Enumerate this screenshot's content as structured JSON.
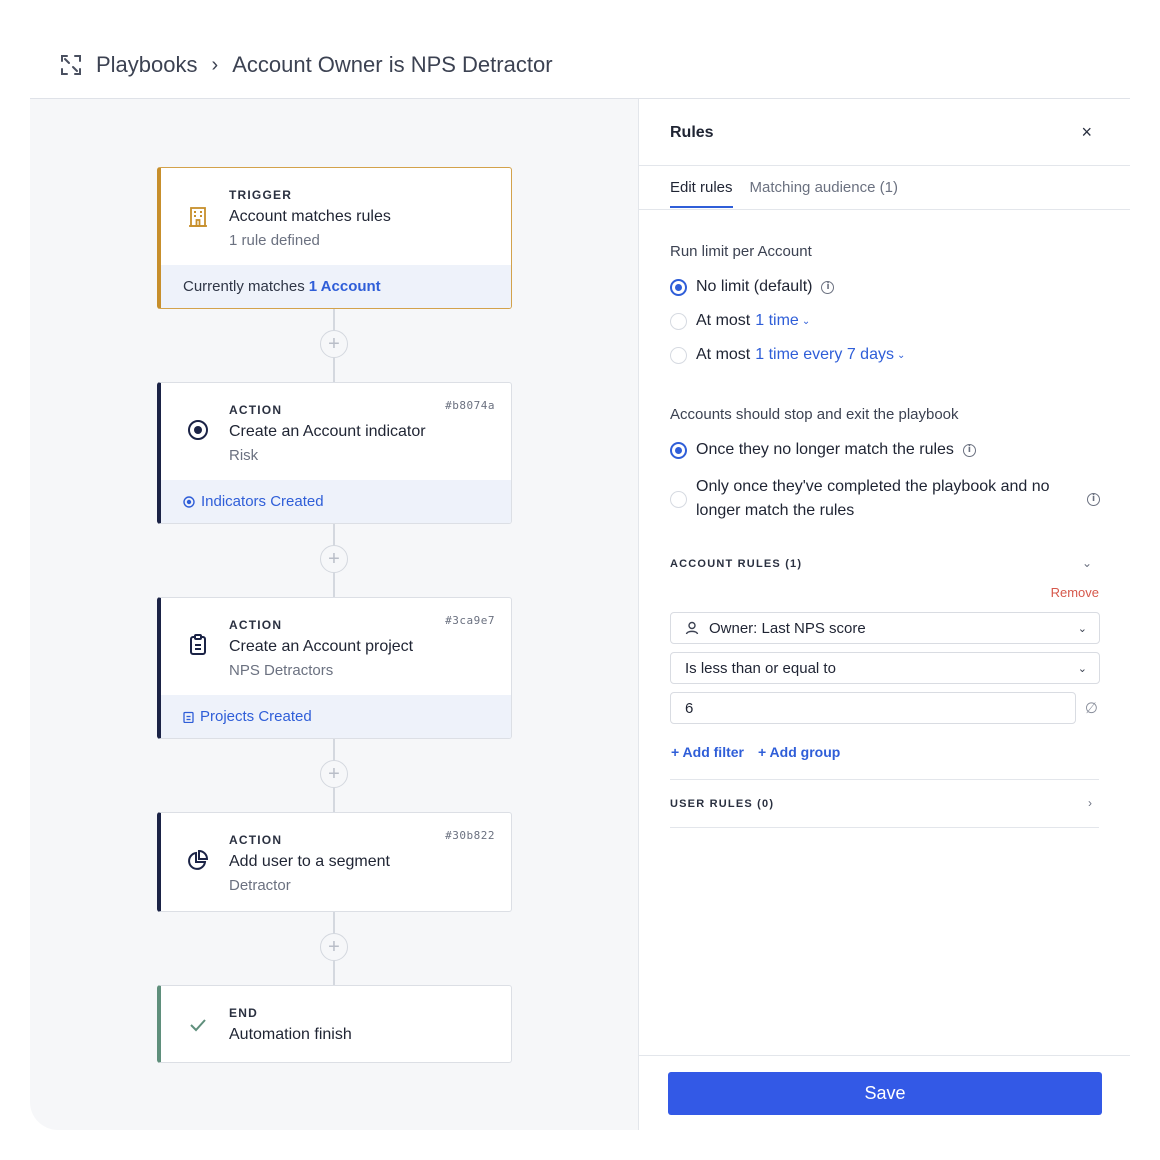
{
  "breadcrumb": {
    "root": "Playbooks",
    "separator": "›",
    "current": "Account Owner is NPS Detractor"
  },
  "flow": {
    "trigger": {
      "kind": "TRIGGER",
      "title": "Account matches rules",
      "subtitle": "1 rule defined",
      "footer_prefix": "Currently matches",
      "footer_link": "1 Account",
      "icon": "building-icon"
    },
    "actions": [
      {
        "kind": "ACTION",
        "id": "#b8074a",
        "title": "Create an Account indicator",
        "subtitle": "Risk",
        "footer": "Indicators Created",
        "icon": "target-icon"
      },
      {
        "kind": "ACTION",
        "id": "#3ca9e7",
        "title": "Create an Account project",
        "subtitle": "NPS Detractors",
        "footer": "Projects Created",
        "icon": "clipboard-icon"
      },
      {
        "kind": "ACTION",
        "id": "#30b822",
        "title": "Add user to a segment",
        "subtitle": "Detractor",
        "icon": "pie-chart-icon"
      }
    ],
    "end": {
      "kind": "END",
      "title": "Automation finish",
      "icon": "check-icon"
    },
    "add_step_symbol": "+"
  },
  "panel": {
    "title": "Rules",
    "close": "×",
    "tabs": [
      "Edit rules",
      "Matching audience (1)"
    ],
    "run_limit": {
      "label": "Run limit per Account",
      "options": [
        {
          "text": "No limit (default)",
          "selected": true
        },
        {
          "text": "At most",
          "link": "1 time",
          "selected": false
        },
        {
          "text": "At most",
          "link": "1 time every 7 days",
          "selected": false
        }
      ]
    },
    "exit": {
      "label": "Accounts should stop and exit the playbook",
      "options": [
        {
          "text": "Once they no longer match the rules",
          "selected": true
        },
        {
          "text_line1": "Only once they've completed the playbook and no",
          "text_line2": "longer match the rules",
          "selected": false
        }
      ]
    },
    "account_rules": {
      "label": "ACCOUNT RULES (1)",
      "remove": "Remove",
      "property": "Owner: Last NPS score",
      "operator": "Is less than or equal to",
      "value": "6",
      "null_symbol": "∅",
      "add_filter": "+ Add filter",
      "add_group": "+ Add group"
    },
    "user_rules": {
      "label": "USER RULES (0)"
    },
    "save": "Save"
  },
  "colors": {
    "accent": "#3359e6",
    "link": "#2f5ed8",
    "trigger_border": "#c78f2c",
    "action_border": "#1b2346",
    "end_border": "#5f8f7c",
    "remove": "#d6584b"
  }
}
